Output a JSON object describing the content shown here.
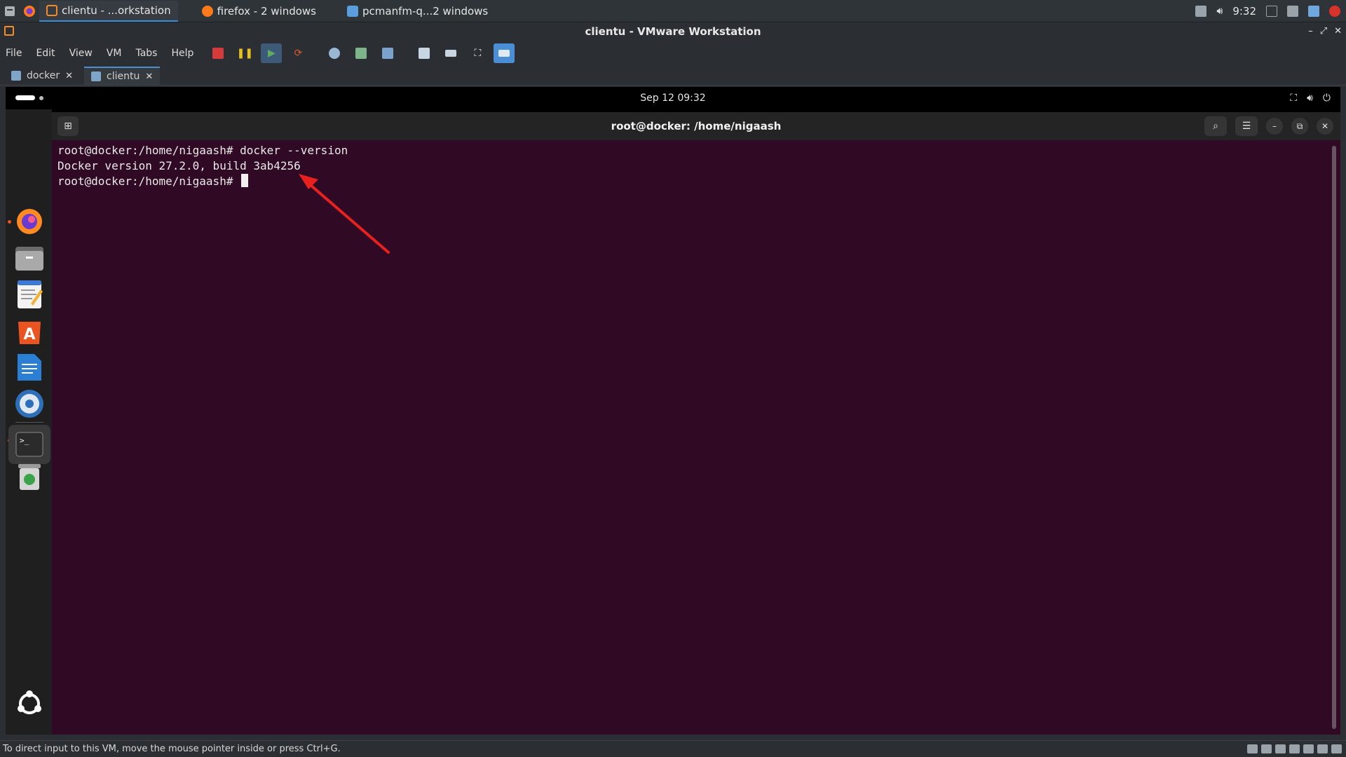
{
  "host_taskbar": {
    "tasks": [
      {
        "label": "clientu - ...orkstation",
        "active": true
      },
      {
        "label": "firefox - 2 windows",
        "active": false
      },
      {
        "label": "pcmanfm-q...2 windows",
        "active": false
      }
    ],
    "clock": "9:32"
  },
  "vmware": {
    "title": "clientu - VMware Workstation",
    "menu": [
      "File",
      "Edit",
      "View",
      "VM",
      "Tabs",
      "Help"
    ],
    "tabs": [
      {
        "label": "docker",
        "close": "✕"
      },
      {
        "label": "clientu",
        "close": "✕"
      }
    ],
    "status_text": "To direct input to this VM, move the mouse pointer inside or press Ctrl+G."
  },
  "guest": {
    "topbar_datetime": "Sep 12  09:32",
    "terminal": {
      "title": "root@docker: /home/nigaash",
      "lines": [
        "root@docker:/home/nigaash# docker --version",
        "Docker version 27.2.0, build 3ab4256",
        "root@docker:/home/nigaash# "
      ]
    }
  },
  "colors": {
    "terminal_bg": "#300a24",
    "annotation_arrow": "#e8201e",
    "ubuntu_orange": "#e95420"
  },
  "icons": {
    "dock": [
      "firefox-icon",
      "files-icon",
      "text-editor-icon",
      "app-center-icon",
      "writer-icon",
      "kde-connect-icon",
      "terminal-icon",
      "trash-icon",
      "show-apps-icon"
    ]
  }
}
